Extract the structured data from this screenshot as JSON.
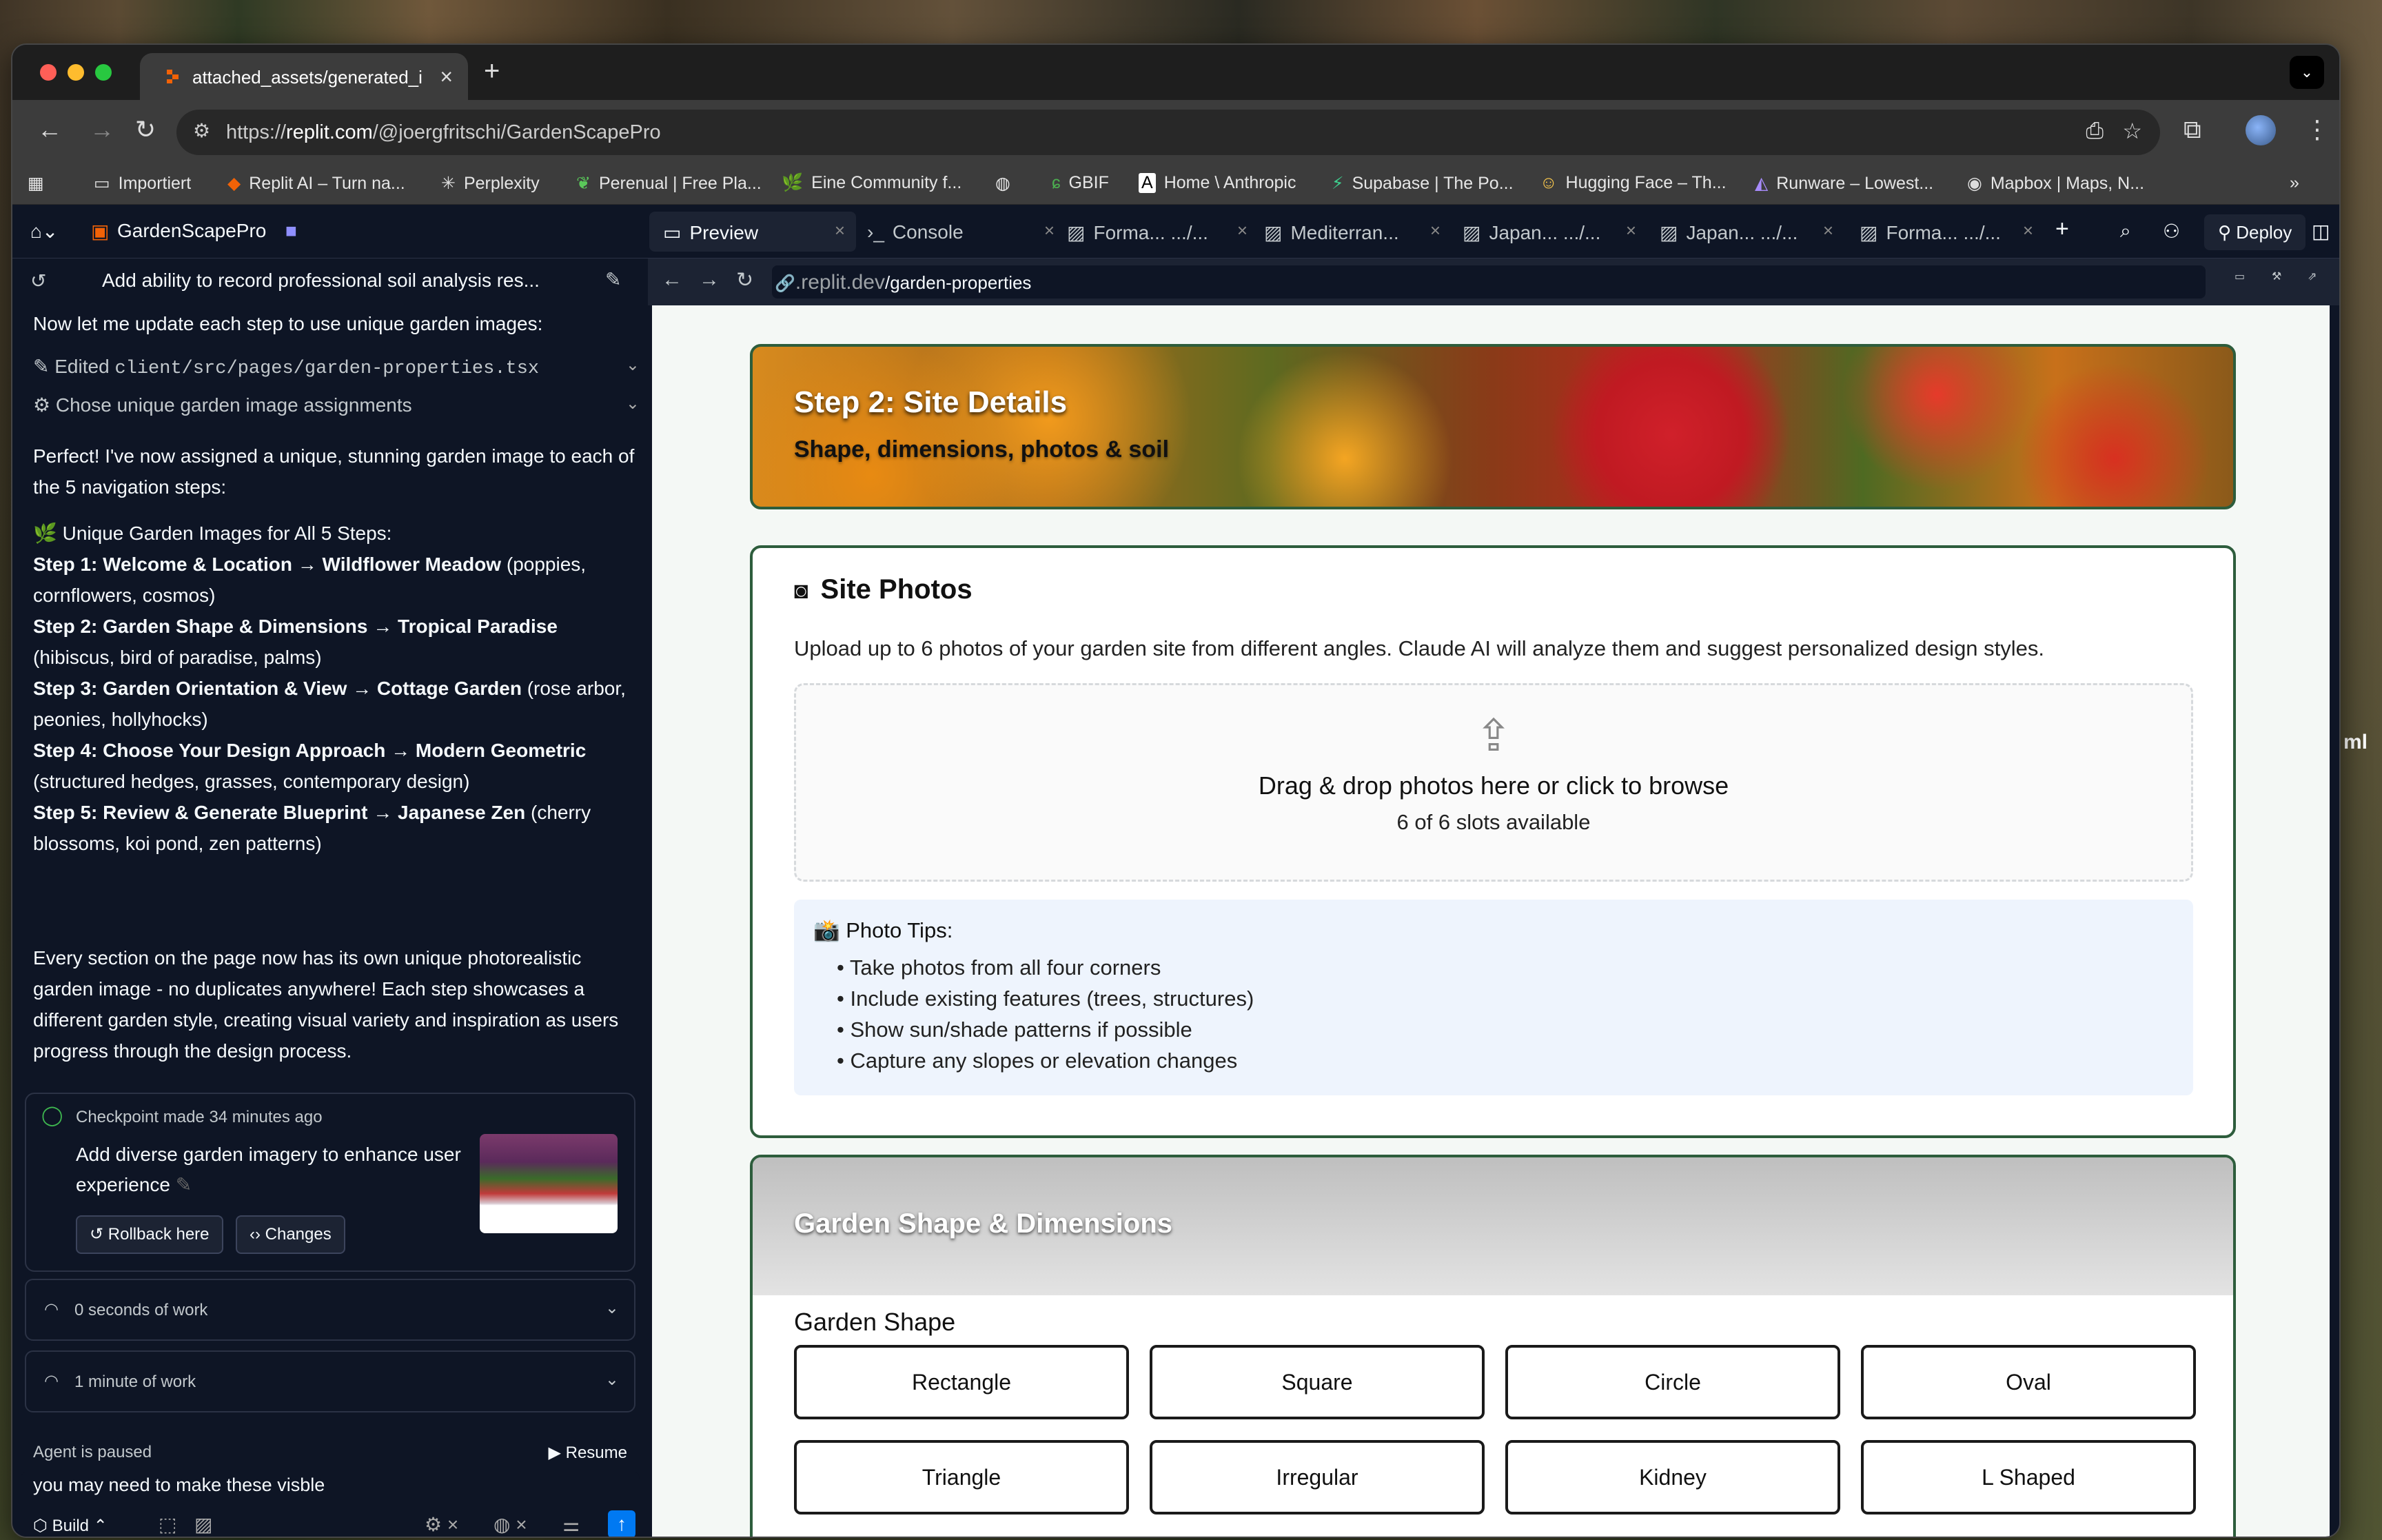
{
  "browser": {
    "tab_title": "attached_assets/generated_i",
    "url_prefix": "https://",
    "url_host": "replit.com",
    "url_path": "/@joergfritschi/GardenScapePro",
    "bookmarks": [
      "Importiert",
      "Replit AI – Turn na...",
      "Perplexity",
      "Perenual | Free Pla...",
      "Eine Community f...",
      "GBIF",
      "Home \\ Anthropic",
      "Supabase | The Po...",
      "Hugging Face – Th...",
      "Runware – Lowest...",
      "Mapbox | Maps, N..."
    ]
  },
  "replit": {
    "project": "GardenScapePro",
    "tabs": [
      "Preview",
      "Console",
      "Forma...",
      ".../...",
      "Mediterran...",
      "Japan...",
      ".../...",
      "Japan...",
      ".../...",
      "Forma...",
      ".../..."
    ],
    "deploy": "Deploy",
    "side_text": "ml"
  },
  "chat": {
    "thread_title": "Add ability to record professional soil analysis res...",
    "msg1": "Now let me update each step to use unique garden images:",
    "edited_label": "Edited",
    "edited_file": "client/src/pages/garden-properties.tsx",
    "chose": "Chose unique garden image assignments",
    "msg2": "Perfect! I've now assigned a unique, stunning garden image to each of the 5 navigation steps:",
    "list_title": "🌿 Unique Garden Images for All 5 Steps:",
    "steps": [
      {
        "b": "Step 1: Welcome & Location → Wildflower Meadow",
        "t": " (poppies, cornflowers, cosmos)"
      },
      {
        "b": "Step 2: Garden Shape & Dimensions → Tropical Paradise",
        "t": " (hibiscus, bird of paradise, palms)"
      },
      {
        "b": "Step 3: Garden Orientation & View → Cottage Garden",
        "t": " (rose arbor, peonies, hollyhocks)"
      },
      {
        "b": "Step 4: Choose Your Design Approach → Modern Geometric",
        "t": " (structured hedges, grasses, contemporary design)"
      },
      {
        "b": "Step 5: Review & Generate Blueprint → Japanese Zen",
        "t": " (cherry blossoms, koi pond, zen patterns)"
      }
    ],
    "msg3": "Every section on the page now has its own unique photorealistic garden image - no duplicates anywhere! Each step showcases a different garden style, creating visual variety and inspiration as users progress through the design process.",
    "checkpoint": "Checkpoint made 34 minutes ago",
    "checkpoint_desc": "Add diverse garden imagery to enhance user experience",
    "rollback": "Rollback here",
    "changes": "Changes",
    "work1": "0 seconds of work",
    "work2": "1 minute of work",
    "paused": "Agent is paused",
    "resume": "Resume",
    "input_value": "you may need to make these visble",
    "build": "Build"
  },
  "preview": {
    "url_host": ".replit.dev",
    "url_path": "/garden-properties",
    "hero_title": "Step 2: Site Details",
    "hero_sub": "Shape, dimensions, photos & soil",
    "photos_title": "Site Photos",
    "photos_desc": "Upload up to 6 photos of your garden site from different angles. Claude AI will analyze them and suggest personalized design styles.",
    "drop_main": "Drag & drop photos here or click to browse",
    "drop_sub": "6 of 6 slots available",
    "tips_title": "📸 Photo Tips:",
    "tips": [
      "• Take photos from all four corners",
      "• Include existing features (trees, structures)",
      "• Show sun/shade patterns if possible",
      "• Capture any slopes or elevation changes"
    ],
    "dims_title": "Garden Shape & Dimensions",
    "shape_label": "Garden Shape",
    "shapes": [
      "Rectangle",
      "Square",
      "Circle",
      "Oval",
      "Triangle",
      "Irregular",
      "Kidney",
      "L Shaped"
    ]
  }
}
